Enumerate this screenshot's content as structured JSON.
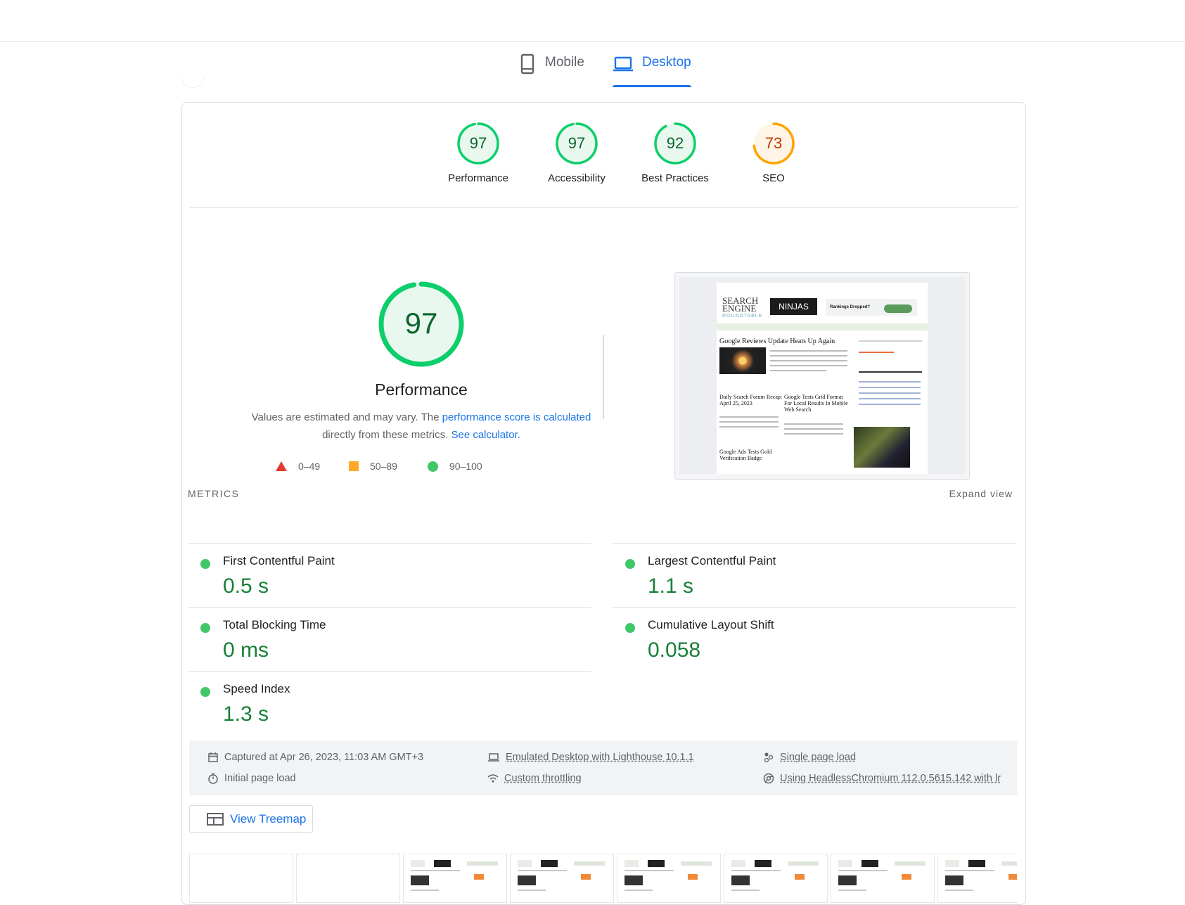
{
  "tabs": [
    {
      "label": "Mobile",
      "icon": "phone-icon",
      "selected": false
    },
    {
      "label": "Desktop",
      "icon": "laptop-icon",
      "selected": true
    }
  ],
  "gauges": [
    {
      "score": "97",
      "label": "Performance",
      "value": 97,
      "color": "#0cce6b",
      "text_color": "#0d652d"
    },
    {
      "score": "97",
      "label": "Accessibility",
      "value": 97,
      "color": "#0cce6b",
      "text_color": "#0d652d"
    },
    {
      "score": "92",
      "label": "Best Practices",
      "value": 92,
      "color": "#0cce6b",
      "text_color": "#0d652d"
    },
    {
      "score": "73",
      "label": "SEO",
      "value": 73,
      "color": "#ffa400",
      "text_color": "#c33300"
    }
  ],
  "performance": {
    "score": "97",
    "value": 97,
    "title": "Performance",
    "desc_pre": "Values are estimated and may vary. The ",
    "desc_link1": "performance score is calculated",
    "desc_mid": " directly from these metrics. ",
    "desc_link2": "See calculator.",
    "legend": [
      {
        "label": "0–49",
        "shape": "triangle",
        "color": "#e53935"
      },
      {
        "label": "50–89",
        "shape": "square",
        "color": "#ffa726"
      },
      {
        "label": "90–100",
        "shape": "circle",
        "color": "#3fc867"
      }
    ]
  },
  "screenshot": {
    "logo_line1": "SEARCH",
    "logo_line2": "ENGINE",
    "logo_line3": "ROUNDTABLE",
    "ninjas": "NINJAS",
    "ad_text": "Rankings Dropped?",
    "headline": "Google Reviews Update Heats Up Again",
    "story2": "Daily Search Forum Recap: April 25, 2023",
    "story3": "Google Tests Grid Format For Local Results In Mobile Web Search",
    "story4": "Google Ads Tests Gold Verification Badge"
  },
  "metrics": {
    "heading": "METRICS",
    "expand": "Expand view",
    "items": [
      {
        "name": "First Contentful Paint",
        "value": "0.5 s"
      },
      {
        "name": "Largest Contentful Paint",
        "value": "1.1 s"
      },
      {
        "name": "Total Blocking Time",
        "value": "0 ms"
      },
      {
        "name": "Cumulative Layout Shift",
        "value": "0.058"
      },
      {
        "name": "Speed Index",
        "value": "1.3 s"
      }
    ]
  },
  "runinfo": {
    "captured": "Captured at Apr 26, 2023, 11:03 AM GMT+3",
    "initial": "Initial page load",
    "emulated": "Emulated Desktop with Lighthouse 10.1.1",
    "throttling": "Custom throttling",
    "single": "Single page load",
    "using": "Using HeadlessChromium 112.0.5615.142 with lr"
  },
  "treemap": {
    "label": "View Treemap"
  }
}
